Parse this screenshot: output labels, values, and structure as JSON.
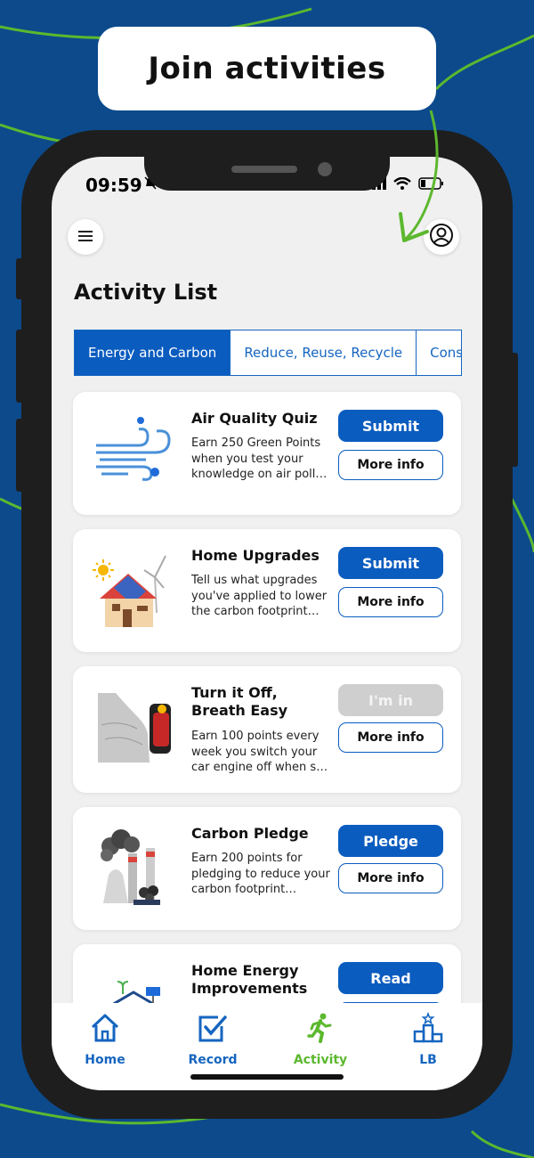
{
  "banner": {
    "text": "Join activities"
  },
  "status_bar": {
    "time": "09:59"
  },
  "page": {
    "title": "Activity List"
  },
  "tabs": [
    {
      "label": "Energy and Carbon",
      "active": true
    },
    {
      "label": "Reduce, Reuse, Recycle",
      "active": false
    },
    {
      "label": "Consum",
      "active": false
    }
  ],
  "activities": [
    {
      "title": "Air Quality Quiz",
      "description": "Earn 250 Green Points when you test your knowledge on air poll…",
      "primary_label": "Submit",
      "secondary_label": "More info",
      "icon": "wind-icon"
    },
    {
      "title": "Home Upgrades",
      "description": "Tell us what upgrades you've applied to lower the carbon footprint…",
      "primary_label": "Submit",
      "secondary_label": "More info",
      "icon": "solar-house-icon"
    },
    {
      "title": "Turn it Off, Breath Easy",
      "description": "Earn 100 points every week you switch your car engine off when s…",
      "primary_label": "I'm in",
      "secondary_label": "More info",
      "icon": "car-exhaust-icon"
    },
    {
      "title": "Carbon Pledge",
      "description": "Earn 200 points for pledging to reduce your carbon footprint…",
      "primary_label": "Pledge",
      "secondary_label": "More info",
      "icon": "factory-smoke-icon"
    },
    {
      "title": "Home Energy Improvements",
      "description": "",
      "primary_label": "Read",
      "secondary_label": "",
      "icon": "green-house-icon"
    }
  ],
  "nav": [
    {
      "label": "Home",
      "icon": "home-icon"
    },
    {
      "label": "Record",
      "icon": "checkbox-icon"
    },
    {
      "label": "Activity",
      "icon": "running-icon",
      "active": true
    },
    {
      "label": "LB",
      "icon": "leaderboard-icon"
    }
  ],
  "colors": {
    "primary": "#0b5cbf",
    "accent_green": "#5cb82e",
    "background": "#0c4a8c",
    "disabled": "#cfcfcf"
  }
}
